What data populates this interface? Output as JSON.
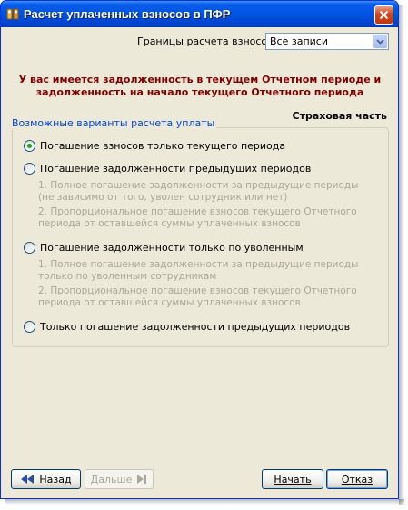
{
  "window": {
    "title": "Расчет уплаченных взносов в ПФР"
  },
  "bounds": {
    "label": "Границы расчета взносов:",
    "selected": "Все записи"
  },
  "warning": {
    "line1": "У вас имеется задолженность в текущем Отчетном периоде и",
    "line2": "задолженность на начало текущего Отчетного периода"
  },
  "section": {
    "title": "Страховая часть"
  },
  "group": {
    "legend": "Возможные варианты расчета уплаты"
  },
  "options": [
    {
      "label": "Погашение взносов только текущего периода",
      "checked": true
    },
    {
      "label": "Погашение задолженности предыдущих периодов",
      "checked": false,
      "notes": [
        "1. Полное погашение задолженности за предыдущие периоды (не зависимо от того, уволен сотрудник или нет)",
        "2. Пропорциональное погашение взносов текущего Отчетного периода от оставшейся суммы уплаченных взносов"
      ]
    },
    {
      "label": "Погашение задолженности только по уволенным",
      "checked": false,
      "notes": [
        "1. Полное погашение задолженности за предыдущие периоды только по уволенным сотрудникам",
        "2. Пропорциональное погашение взносов текущего Отчетного периода от оставшейся суммы уплаченных взносов"
      ]
    },
    {
      "label": "Только погашение задолженности предыдущих периодов",
      "checked": false
    }
  ],
  "buttons": {
    "back": "Назад",
    "next": "Дальше",
    "start": "Начать",
    "cancel": "Отказ"
  },
  "colors": {
    "titlebar": "#0055e5",
    "warning": "#800000",
    "legend": "#0046d5",
    "disabled": "#aca899",
    "radio_dot": "#21a121"
  }
}
